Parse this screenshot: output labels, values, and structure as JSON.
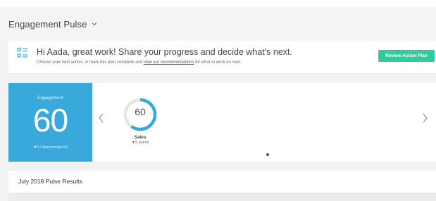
{
  "header": {
    "title": "Engagement Pulse",
    "dropdown_icon": "chevron-down-icon"
  },
  "banner": {
    "icon": "plan-list-icon",
    "headline": "Hi Aada, great work! Share your progress and decide what's next.",
    "sub_before": "Choose your next action, or mark this plan complete and ",
    "sub_link": "view our recommendations",
    "sub_after": " for what to work on next.",
    "button_label": "Review Action Plan"
  },
  "engagement": {
    "label": "Engagement",
    "value": "60",
    "benchmark": "▼5 / Benchmark 69"
  },
  "carousel": {
    "items": [
      {
        "value": "60",
        "progress": 0.6,
        "label": "Sales",
        "delta": "▼5 points"
      }
    ],
    "prev_icon": "chevron-left-icon",
    "next_icon": "chevron-right-icon"
  },
  "results": {
    "title": "July 2018 Pulse Results"
  },
  "colors": {
    "accent": "#39a9db",
    "button": "#2ecc9f",
    "track": "#e6e6e6"
  }
}
